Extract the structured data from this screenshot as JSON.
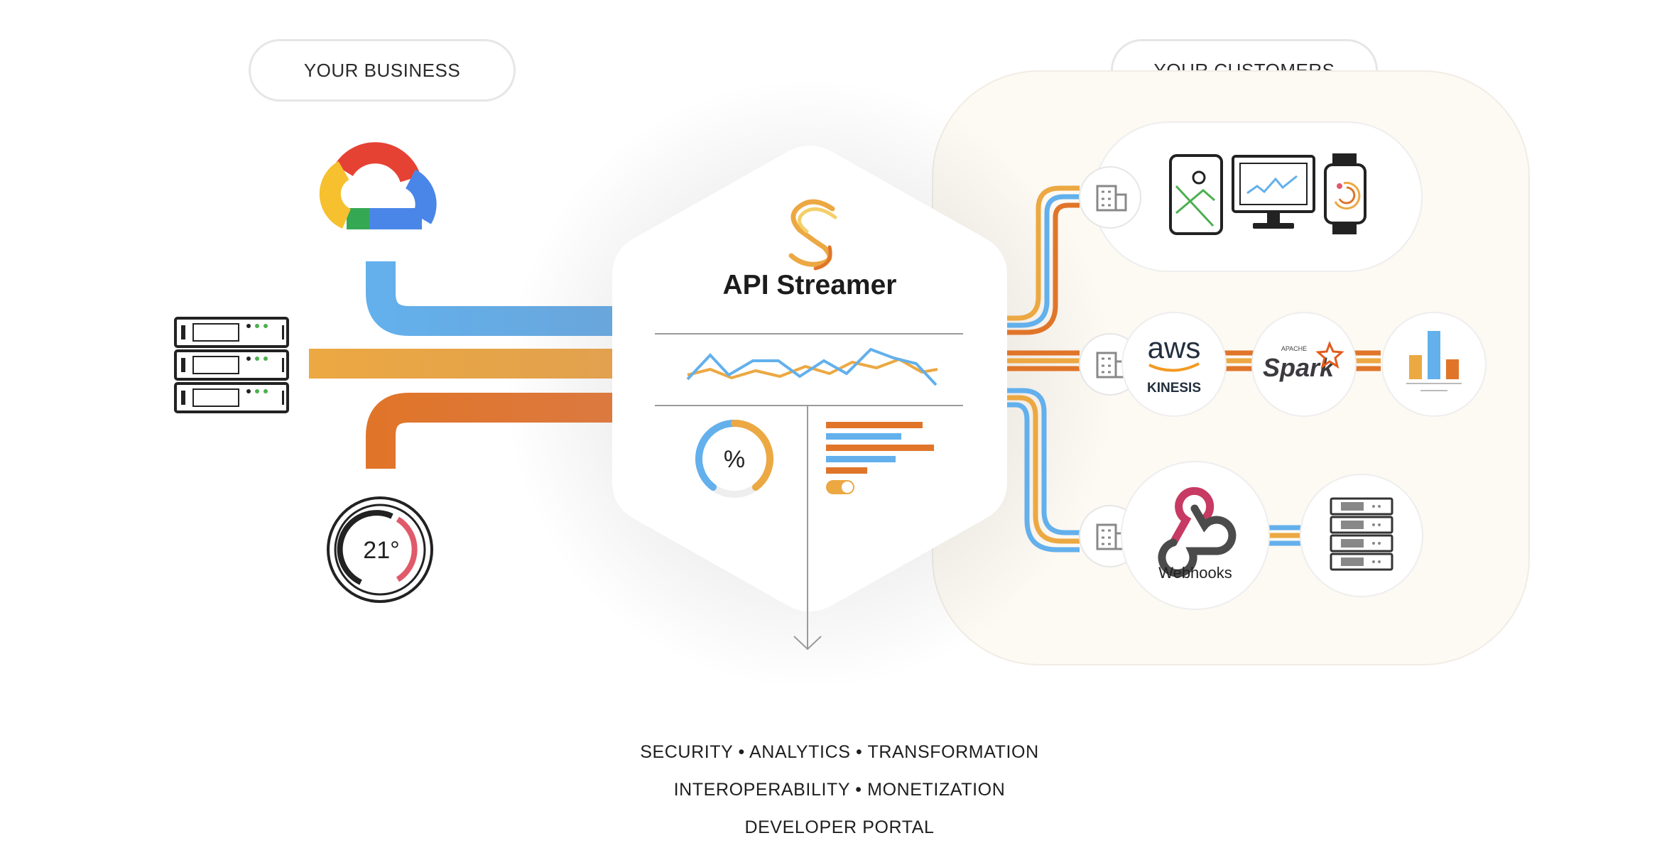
{
  "labels": {
    "business": "YOUR BUSINESS",
    "customers": "YOUR CUSTOMERS"
  },
  "hub": {
    "title": "API Streamer",
    "percent_symbol": "%"
  },
  "sources": {
    "thermostat_reading": "21°"
  },
  "destinations": {
    "aws_word": "aws",
    "kinesis": "KINESIS",
    "apache_word": "APACHE",
    "spark": "Spark",
    "webhooks": "Webhooks"
  },
  "footer": {
    "line1": "SECURITY • ANALYTICS • TRANSFORMATION",
    "line2": "INTEROPERABILITY • MONETIZATION",
    "line3": "DEVELOPER PORTAL"
  },
  "colors": {
    "blue": "#63b0ec",
    "yellow": "#eca842",
    "orange": "#e0752a",
    "panel": "#fdf9f3",
    "grey_line": "#9a9a9a"
  }
}
